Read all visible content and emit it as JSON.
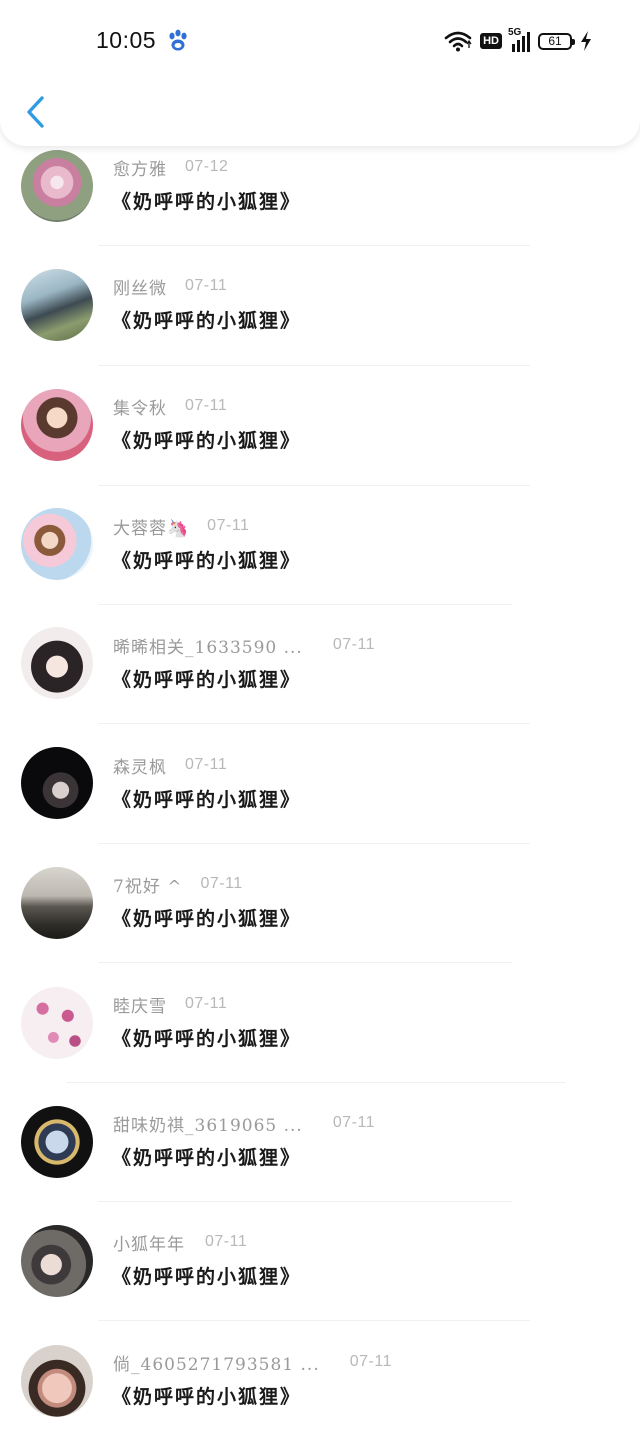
{
  "status": {
    "time": "10:05",
    "hd": "HD",
    "network": "5G",
    "battery": "61"
  },
  "header": {
    "back_icon": "chevron-left-icon",
    "accent": "#2f9be0"
  },
  "items": [
    {
      "name": "愈方雅",
      "date": "07-12",
      "title": "《奶呼呼的小狐狸》"
    },
    {
      "name": "刚丝微",
      "date": "07-11",
      "title": "《奶呼呼的小狐狸》"
    },
    {
      "name": "集令秋",
      "date": "07-11",
      "title": "《奶呼呼的小狐狸》"
    },
    {
      "name": "大蓉蓉🦄",
      "date": "07-11",
      "title": "《奶呼呼的小狐狸》"
    },
    {
      "name": "晞晞相关_1633590 ...",
      "date": "07-11",
      "title": "《奶呼呼的小狐狸》"
    },
    {
      "name": "森灵枫",
      "date": "07-11",
      "title": "《奶呼呼的小狐狸》"
    },
    {
      "name": "7祝好 ^",
      "date": "07-11",
      "title": "《奶呼呼的小狐狸》"
    },
    {
      "name": "睦庆雪",
      "date": "07-11",
      "title": "《奶呼呼的小狐狸》"
    },
    {
      "name": "甜味奶祺_3619065 ...",
      "date": "07-11",
      "title": "《奶呼呼的小狐狸》"
    },
    {
      "name": "小狐年年",
      "date": "07-11",
      "title": "《奶呼呼的小狐狸》"
    },
    {
      "name": "倘_4605271793581 ...",
      "date": "07-11",
      "title": "《奶呼呼的小狐狸》"
    }
  ]
}
